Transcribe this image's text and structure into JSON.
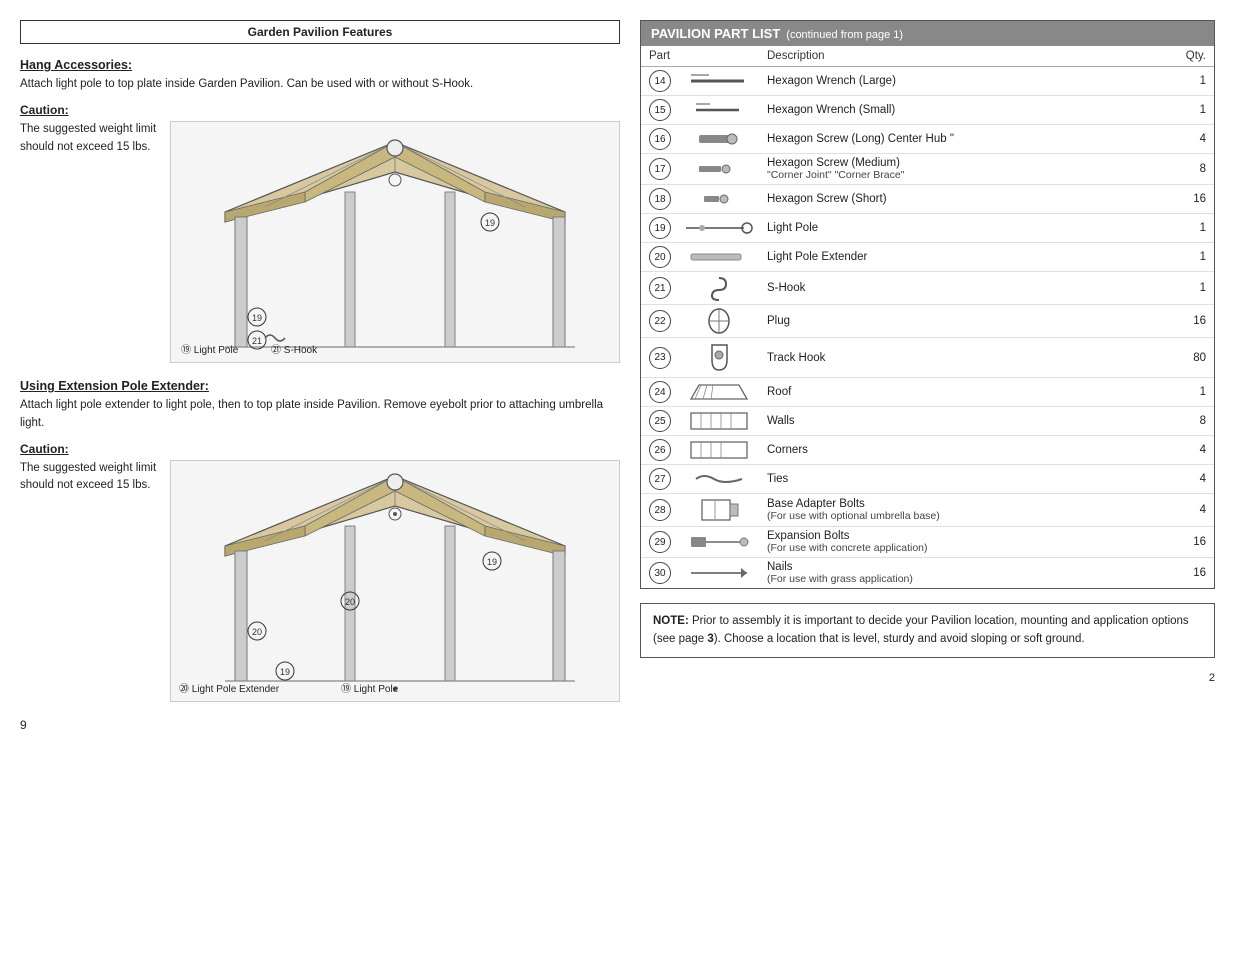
{
  "left": {
    "section_title": "Garden Pavilion Features",
    "hang_accessories": {
      "heading": "Hang Accessories:",
      "text": "Attach light pole to top plate inside Garden Pavilion. Can be used with or without S-Hook.",
      "caution_heading": "Caution:",
      "caution_text": "The suggested weight limit should not exceed 15 lbs.",
      "label_19": "⑲ Light Pole",
      "label_21": "㉑ S-Hook"
    },
    "extension_pole": {
      "heading": "Using Extension Pole Extender:",
      "text": "Attach light pole extender to light pole, then to top plate inside Pavilion. Remove eyebolt prior to attaching umbrella light.",
      "caution_heading": "Caution:",
      "caution_text": "The suggested weight limit should not exceed 15 lbs.",
      "label_20a": "⑳ Light Pole Extender",
      "label_20b": "⑳",
      "label_19a": "⑲",
      "label_19b": "⑲ Light Pole"
    },
    "page_number": "9"
  },
  "right": {
    "table_title": "PAVILION PART LIST",
    "table_subtitle": "(continued from page 1)",
    "columns": {
      "part": "Part",
      "description": "Description",
      "qty": "Qty."
    },
    "rows": [
      {
        "num": "14",
        "desc": "Hexagon Wrench (Large)",
        "qty": "1"
      },
      {
        "num": "15",
        "desc": "Hexagon Wrench (Small)",
        "qty": "1"
      },
      {
        "num": "16",
        "desc": "Hexagon Screw (Long) Center Hub \"",
        "qty": "4"
      },
      {
        "num": "17",
        "desc": "Hexagon Screw (Medium)",
        "desc_sub": "\"Corner Joint\" \"Corner Brace\"",
        "qty": "8"
      },
      {
        "num": "18",
        "desc": "Hexagon Screw (Short)",
        "qty": "16"
      },
      {
        "num": "19",
        "desc": "Light Pole",
        "qty": "1"
      },
      {
        "num": "20",
        "desc": "Light Pole Extender",
        "qty": "1"
      },
      {
        "num": "21",
        "desc": "S-Hook",
        "qty": "1"
      },
      {
        "num": "22",
        "desc": "Plug",
        "qty": "16"
      },
      {
        "num": "23",
        "desc": "Track Hook",
        "qty": "80"
      },
      {
        "num": "24",
        "desc": "Roof",
        "qty": "1"
      },
      {
        "num": "25",
        "desc": "Walls",
        "qty": "8"
      },
      {
        "num": "26",
        "desc": "Corners",
        "qty": "4"
      },
      {
        "num": "27",
        "desc": "Ties",
        "qty": "4"
      },
      {
        "num": "28",
        "desc": "Base Adapter Bolts",
        "desc_sub": "(For use with optional umbrella base)",
        "qty": "4"
      },
      {
        "num": "29",
        "desc": "Expansion Bolts",
        "desc_sub": "(For use with concrete application)",
        "qty": "16"
      },
      {
        "num": "30",
        "desc": "Nails",
        "desc_sub": "(For use with grass application)",
        "qty": "16"
      }
    ],
    "note": "NOTE:  Prior to assembly it is important to decide your Pavilion location, mounting and application options (see page 3).  Choose a location that is level, sturdy and avoid sloping or soft ground.",
    "page_number": "2"
  }
}
